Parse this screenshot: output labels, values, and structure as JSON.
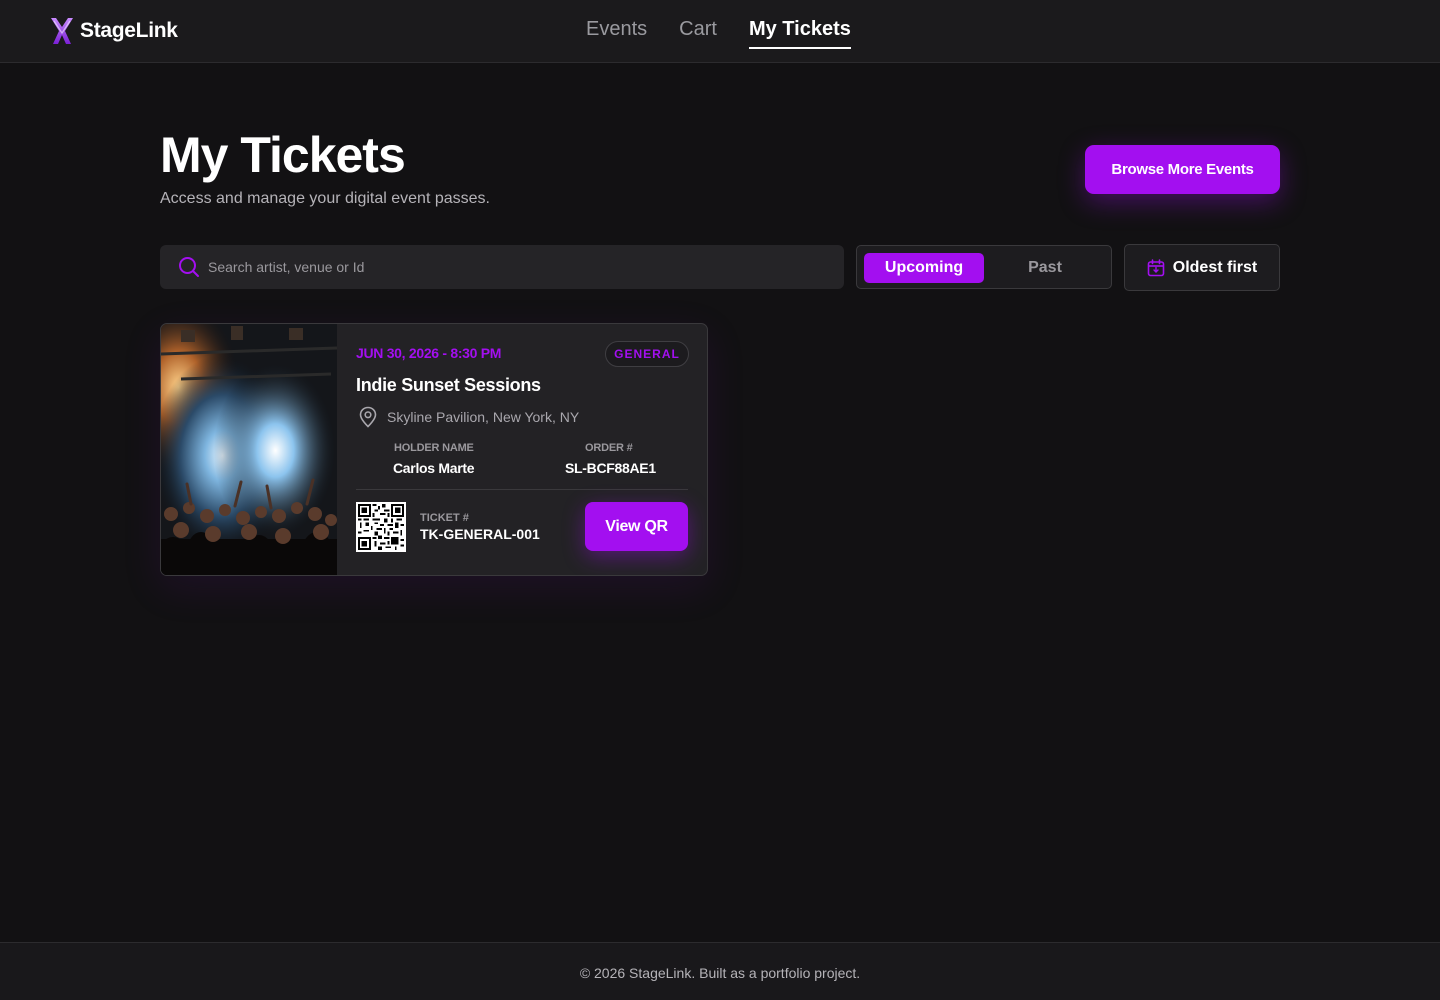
{
  "brand": {
    "name": "StageLink"
  },
  "nav": {
    "items": [
      {
        "label": "Events"
      },
      {
        "label": "Cart"
      },
      {
        "label": "My Tickets"
      }
    ],
    "active": "My Tickets"
  },
  "page": {
    "title": "My Tickets",
    "subtitle": "Access and manage your digital event passes.",
    "browse_label": "Browse More Events"
  },
  "toolbar": {
    "search_placeholder": "Search artist, venue or Id",
    "search_value": "",
    "filter_upcoming": "Upcoming",
    "filter_past": "Past",
    "filter_selected": "Upcoming",
    "sort_label": "Oldest first"
  },
  "tickets": [
    {
      "date": "JUN 30, 2026 - 8:30 PM",
      "badge": "GENERAL",
      "title": "Indie Sunset Sessions",
      "venue": "Skyline Pavilion, New York, NY",
      "holder_label": "HOLDER NAME",
      "holder_name": "Carlos Marte",
      "order_label": "ORDER #",
      "order_id": "SL-BCF88AE1",
      "ticket_label": "TICKET #",
      "ticket_id": "TK-GENERAL-001",
      "qr_button": "View QR"
    }
  ],
  "footer": {
    "text": "© 2026 StageLink. Built as a portfolio project."
  },
  "colors": {
    "accent": "#a30ff0",
    "background": "#121113",
    "surface": "#232225"
  },
  "icons": [
    "brand-logo-icon",
    "search-icon",
    "calendar-icon",
    "location-pin-icon",
    "qr-code-icon"
  ]
}
